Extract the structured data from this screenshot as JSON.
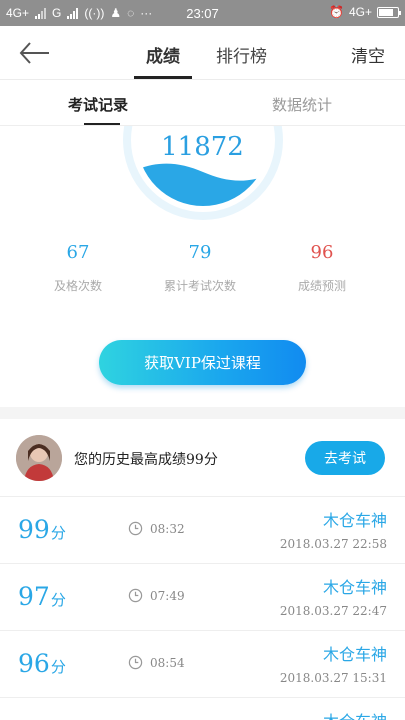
{
  "status_bar": {
    "left_label_1": "4G+",
    "left_label_2": "G",
    "time": "23:07",
    "right_label": "4G+"
  },
  "nav": {
    "tabs": [
      "成绩",
      "排行榜"
    ],
    "clear_label": "清空"
  },
  "sub_tabs": [
    "考试记录",
    "数据统计"
  ],
  "gauge": {
    "value": "11872",
    "fill_level": 0.45,
    "color": "#2aa7e6"
  },
  "stats": [
    {
      "value": "67",
      "label": "及格次数",
      "color": "#2aa7e6"
    },
    {
      "value": "79",
      "label": "累计考试次数",
      "color": "#2aa7e6"
    },
    {
      "value": "96",
      "label": "成绩预测",
      "color": "#e0524e"
    }
  ],
  "vip_button": "获取VIP保过课程",
  "history": {
    "text": "您的历史最高成绩99分",
    "button": "去考试"
  },
  "records": [
    {
      "score": "99",
      "unit": "分",
      "duration": "08:32",
      "user": "木仓车神",
      "date": "2018.03.27  22:58"
    },
    {
      "score": "97",
      "unit": "分",
      "duration": "07:49",
      "user": "木仓车神",
      "date": "2018.03.27  22:47"
    },
    {
      "score": "96",
      "unit": "分",
      "duration": "08:54",
      "user": "木仓车神",
      "date": "2018.03.27  15:31"
    },
    {
      "score": "",
      "unit": "",
      "duration": "",
      "user": "木仓车神",
      "date": ""
    }
  ]
}
